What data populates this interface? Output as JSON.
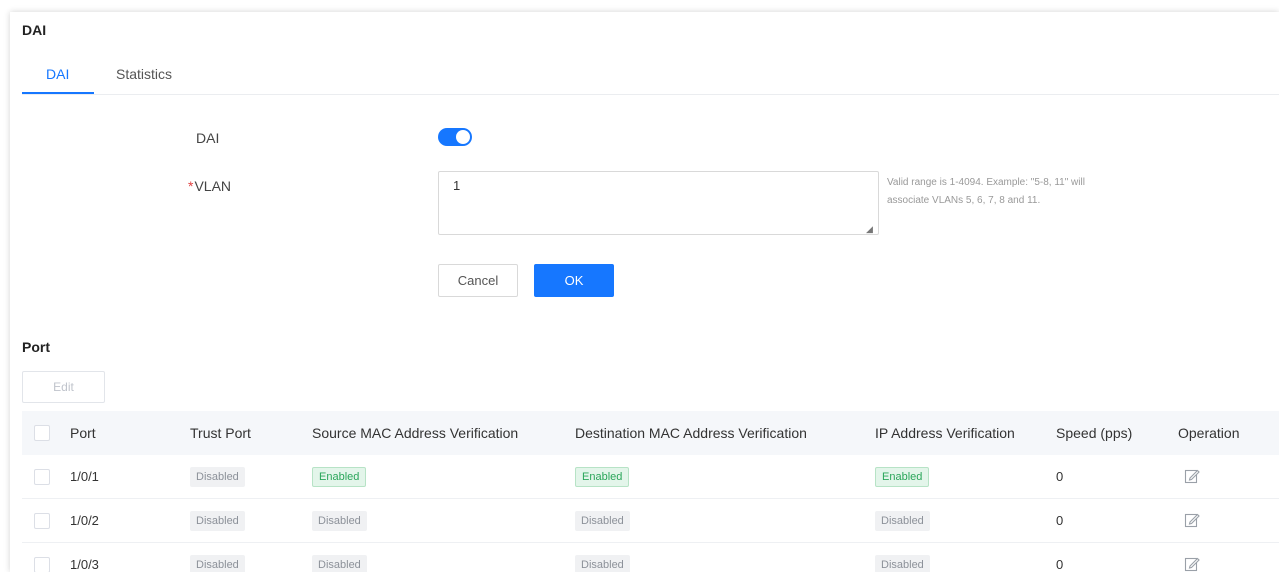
{
  "page": {
    "title": "DAI"
  },
  "tabs": [
    {
      "label": "DAI",
      "active": true
    },
    {
      "label": "Statistics",
      "active": false
    }
  ],
  "form": {
    "dai_label": "DAI",
    "dai_enabled": true,
    "vlan_required_mark": "*",
    "vlan_label": "VLAN",
    "vlan_value": "1",
    "vlan_hint": "Valid range is 1-4094. Example: \"5-8, 11\" will associate VLANs 5, 6, 7, 8 and 11.",
    "cancel_label": "Cancel",
    "ok_label": "OK"
  },
  "port_section": {
    "title": "Port",
    "edit_label": "Edit",
    "columns": [
      "Port",
      "Trust Port",
      "Source MAC Address Verification",
      "Destination MAC Address Verification",
      "IP Address Verification",
      "Speed (pps)",
      "Operation"
    ],
    "rows": [
      {
        "port": "1/0/1",
        "trust": "Disabled",
        "src_mac": "Enabled",
        "dst_mac": "Enabled",
        "ip": "Enabled",
        "speed": "0"
      },
      {
        "port": "1/0/2",
        "trust": "Disabled",
        "src_mac": "Disabled",
        "dst_mac": "Disabled",
        "ip": "Disabled",
        "speed": "0"
      },
      {
        "port": "1/0/3",
        "trust": "Disabled",
        "src_mac": "Disabled",
        "dst_mac": "Disabled",
        "ip": "Disabled",
        "speed": "0"
      }
    ]
  },
  "colors": {
    "accent": "#1677ff",
    "enabled_text": "#2aa65a",
    "enabled_bg": "#e3f5ea",
    "disabled_bg": "#f0f1f3"
  },
  "icons": {
    "operation": "edit-icon",
    "resize": "resize-grip-icon"
  }
}
